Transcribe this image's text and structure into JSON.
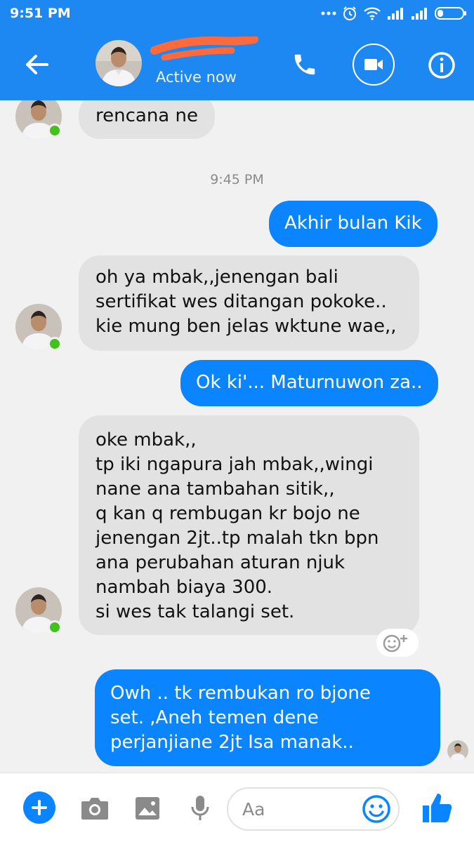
{
  "status_bar": {
    "time": "9:51 PM"
  },
  "header": {
    "status": "Active now",
    "icons": [
      "arrow-left-icon",
      "phone-icon",
      "video-camera-icon",
      "info-icon"
    ]
  },
  "messages": [
    {
      "direction": "incoming",
      "lines": [
        "rencana ne"
      ]
    },
    {
      "type": "timestamp",
      "text": "9:45 PM"
    },
    {
      "direction": "outgoing",
      "lines": [
        "Akhir bulan Kik"
      ]
    },
    {
      "direction": "incoming",
      "lines": [
        "oh ya mbak,,jenengan bali",
        "sertifikat wes ditangan pokoke..",
        "kie mung ben jelas wktune wae,,"
      ]
    },
    {
      "direction": "outgoing",
      "lines": [
        "Ok ki'... Maturnuwon za.."
      ]
    },
    {
      "direction": "incoming",
      "lines": [
        "oke mbak,,",
        "tp iki ngapura jah mbak,,wingi",
        "nane ana tambahan sitik,,",
        "q kan q rembugan kr bojo ne",
        "jenengan 2jt..tp malah tkn bpn",
        "ana perubahan aturan njuk",
        "nambah biaya 300.",
        "si wes tak talangi set."
      ]
    },
    {
      "direction": "outgoing",
      "lines": [
        "Owh .. tk rembukan ro bjone",
        "set.  ,Aneh temen dene",
        "perjanjiane 2jt Isa manak.."
      ]
    }
  ],
  "composer": {
    "placeholder": "Aa",
    "icons": [
      "plus-icon",
      "camera-icon",
      "image-icon",
      "microphone-icon",
      "emoji-icon",
      "thumbs-up-icon"
    ]
  },
  "colors": {
    "header_bg": "#1e88f2",
    "outgoing_bubble": "#0a84ff",
    "incoming_bubble": "#e2e2e2",
    "chat_bg": "#f1f1f1",
    "online_dot": "#42c01c"
  }
}
